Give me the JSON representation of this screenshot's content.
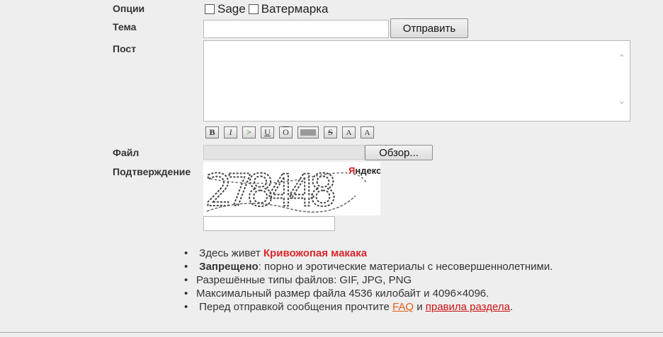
{
  "form": {
    "options_label": "Опции",
    "sage_label": "Sage",
    "watermark_label": "Ватермарка",
    "subject_label": "Тема",
    "subject_value": "",
    "submit_label": "Отправить",
    "post_label": "Пост",
    "post_value": "",
    "file_label": "Файл",
    "browse_label": "Обзор...",
    "confirm_label": "Подтверждение",
    "captcha_value": "",
    "captcha_brand": "Яндекс",
    "captcha_text": "278448"
  },
  "format_buttons": [
    {
      "label": "B",
      "name": "bold"
    },
    {
      "label": "I",
      "name": "italic"
    },
    {
      "label": ">",
      "name": "quote"
    },
    {
      "label": "U",
      "name": "underline"
    },
    {
      "label": "O",
      "name": "overline"
    },
    {
      "label": "",
      "name": "spoiler"
    },
    {
      "label": "S",
      "name": "strike"
    },
    {
      "label": "A",
      "name": "subscript"
    },
    {
      "label": "A",
      "name": "superscript"
    }
  ],
  "rules": {
    "r1_prefix": "Здесь живет ",
    "r1_highlight": "Кривожопая макака",
    "r2_bold": "Запрещено",
    "r2_rest": ": порно и эротические материалы с несовершеннолетними.",
    "r3": "Разрешённые типы файлов: GIF, JPG, PNG",
    "r4": "Максимальный размер файла 4536 килобайт и 4096×4096.",
    "r5_prefix": "Перед отправкой сообщения прочтите ",
    "r5_link1": "FAQ",
    "r5_mid": " и ",
    "r5_link2": "правила раздела",
    "r5_suffix": "."
  }
}
